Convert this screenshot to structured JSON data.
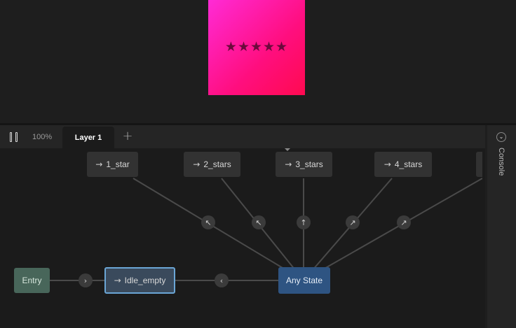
{
  "preview": {
    "stars": "★★★★★",
    "artboard_colors": [
      "#ff2bd6",
      "#ff0a50"
    ]
  },
  "toolbar": {
    "pause_icon": "pause-icon",
    "zoom": "100%",
    "active_tab": "Layer 1",
    "add_tab": "+"
  },
  "state_machine": {
    "arrow_glyph": "→",
    "states": {
      "one_star": "1_star",
      "two_stars": "2_stars",
      "three_stars": "3_stars",
      "four_stars": "4_stars",
      "entry": "Entry",
      "idle_empty": "Idle_empty",
      "any_state": "Any State"
    },
    "transitions": {
      "t1": "↖",
      "t2": "↖",
      "t3": "↑",
      "t4": "↗",
      "t5": "↗",
      "entry_to_idle": "›",
      "any_to_idle": "‹"
    },
    "colors": {
      "entry": "#48665a",
      "idle_border": "#6ba6d6",
      "any_state": "#2e5482"
    }
  },
  "console": {
    "label": "Console",
    "toggle_icon": "chevron-down-icon",
    "toggle_glyph": "⌄"
  }
}
